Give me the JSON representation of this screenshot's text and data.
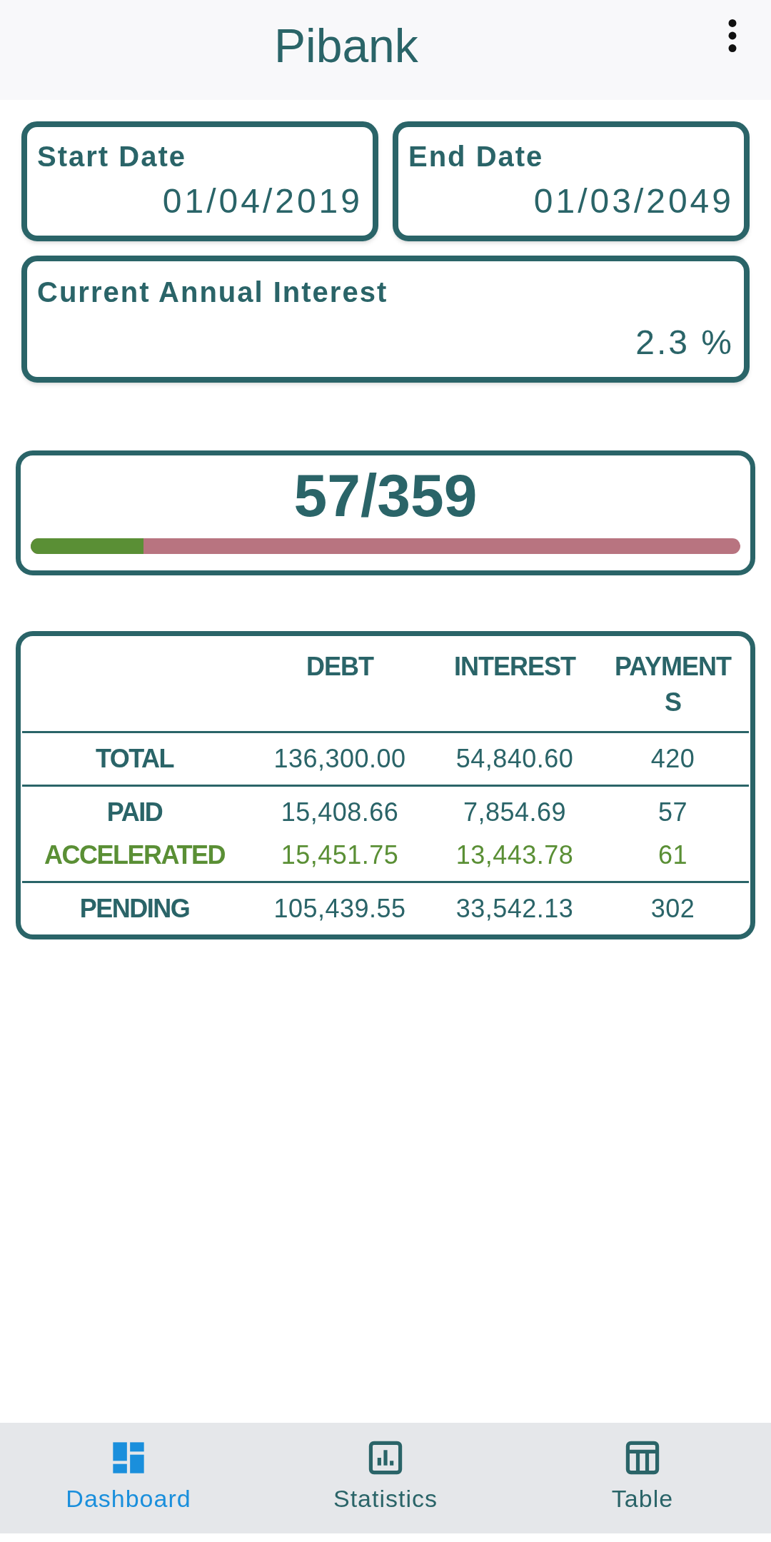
{
  "app_bar": {
    "title": "Pibank"
  },
  "date_cards": [
    {
      "label": "Start Date",
      "value": "01/04/2019"
    },
    {
      "label": "End Date",
      "value": "01/03/2049"
    }
  ],
  "interest_card": {
    "label": "Current Annual Interest",
    "value": "2.3 %"
  },
  "progress": {
    "reading": "57/359",
    "level": 0.159
  },
  "summary_table": {
    "columns": [
      "DEBT",
      "INTEREST",
      "PAYMENTS"
    ],
    "row_groups": [
      {
        "rows": [
          {
            "kind": "normal",
            "label": "TOTAL",
            "cells": [
              "136,300.00",
              "54,840.60",
              "420"
            ]
          }
        ]
      },
      {
        "rows": [
          {
            "kind": "normal",
            "label": "PAID",
            "cells": [
              "15,408.66",
              "7,854.69",
              "57"
            ]
          },
          {
            "kind": "accelerated",
            "label": "ACCELERATED",
            "cells": [
              "15,451.75",
              "13,443.78",
              "61"
            ]
          }
        ]
      },
      {
        "rows": [
          {
            "kind": "normal",
            "label": "PENDING",
            "cells": [
              "105,439.55",
              "33,542.13",
              "302"
            ]
          }
        ]
      }
    ]
  },
  "bottom_nav": [
    {
      "kind": "dashboard",
      "label": "Dashboard",
      "selected": true
    },
    {
      "kind": "statistics",
      "label": "Statistics",
      "selected": false
    },
    {
      "kind": "table",
      "label": "Table",
      "selected": false
    }
  ]
}
